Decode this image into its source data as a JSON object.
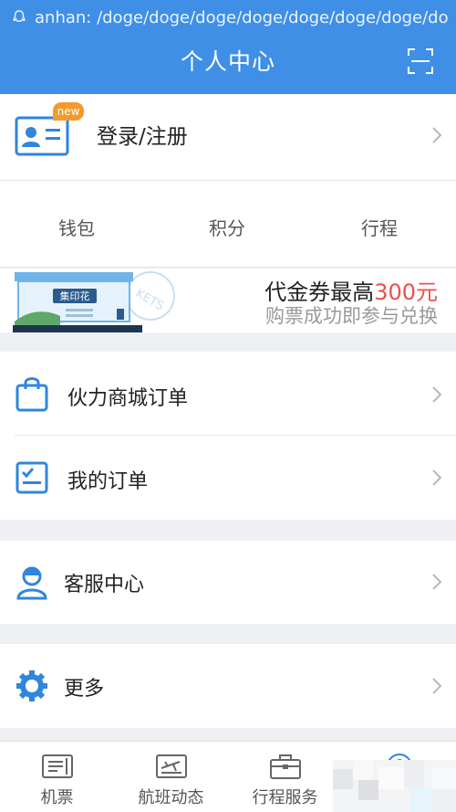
{
  "status_bar": {
    "url_text": "anhan: /doge/doge/doge/doge/doge/doge/doge/do"
  },
  "header": {
    "title": "个人中心"
  },
  "login": {
    "badge": "new",
    "label": "登录/注册"
  },
  "quick_links": [
    {
      "label": "钱包"
    },
    {
      "label": "积分"
    },
    {
      "label": "行程"
    }
  ],
  "banner": {
    "stamp_text": "集印花",
    "line1_prefix": "代金券最高",
    "line1_amount": "300元",
    "line2": "购票成功即参与兑换",
    "accent_color": "#ea4f4a"
  },
  "menu": {
    "mall_orders": "伙力商城订单",
    "my_orders": "我的订单",
    "customer_service": "客服中心",
    "more": "更多"
  },
  "tabs": [
    {
      "label": "机票",
      "icon": "ticket-icon"
    },
    {
      "label": "航班动态",
      "icon": "flight-status-icon"
    },
    {
      "label": "行程服务",
      "icon": "briefcase-icon"
    },
    {
      "label": "",
      "icon": "profile-icon",
      "active": true
    }
  ],
  "colors": {
    "primary": "#3f8fe6",
    "badge": "#f39a2c"
  }
}
